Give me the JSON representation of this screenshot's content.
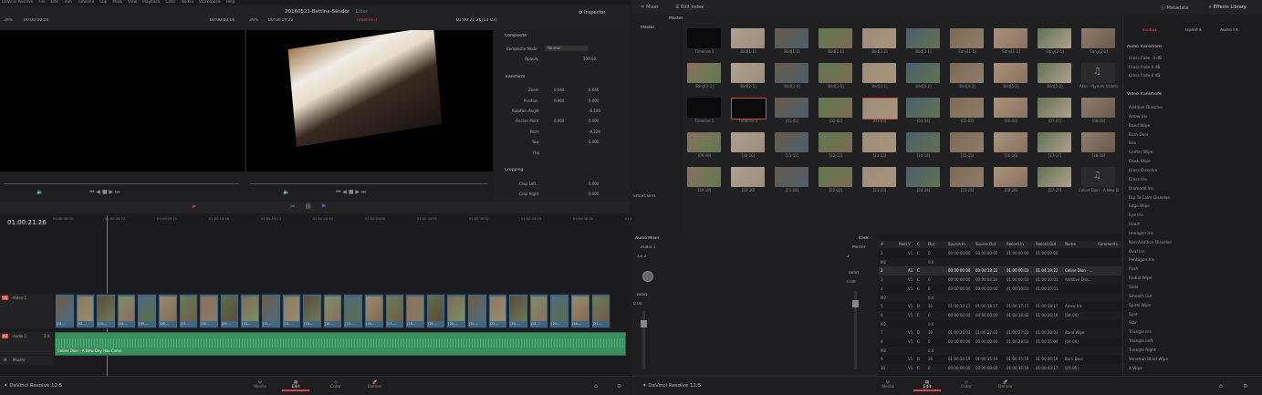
{
  "menubar": {
    "items": [
      "DaVinci Resolve",
      "File",
      "Edit",
      "Trim",
      "Timeline",
      "Clip",
      "Mark",
      "View",
      "Playback",
      "Color",
      "Nodes",
      "Workspace",
      "Help"
    ]
  },
  "source_viewer": {
    "zoom": "39%",
    "timecode": "00:00:00:00",
    "end_tc": "00:00:00:00"
  },
  "timeline_viewer": {
    "title": "20160521-Bettina-Sándor",
    "status": "Edited",
    "zoom": "39%",
    "duration": "00:04:19:22",
    "timeline_name": "Timeline 3",
    "timecode": "01:00:21:26",
    "clip_tag": "[03-03]"
  },
  "inspector": {
    "tab": "Inspector",
    "composite": {
      "header": "Composite",
      "mode_label": "Composite Mode",
      "mode_value": "Normal",
      "opacity_label": "Opacity",
      "opacity_value": "100.00"
    },
    "transform": {
      "header": "Transform",
      "zoom_label": "Zoom",
      "zoom_x": "0.640",
      "zoom_y": "0.640",
      "position_label": "Position",
      "pos_x": "0.000",
      "pos_y": "0.000",
      "rotation_label": "Rotation Angle",
      "rotation_value": "-6.100",
      "anchor_label": "Anchor Point",
      "anchor_x": "0.000",
      "anchor_y": "0.000",
      "pitch_label": "Pitch",
      "pitch_value": "-0.229",
      "yaw_label": "Yaw",
      "yaw_value": "0.000",
      "flip_label": "Flip"
    },
    "cropping": {
      "header": "Cropping",
      "crop_left_label": "Crop Left",
      "crop_left": "0.000",
      "crop_right_label": "Crop Right",
      "crop_right": "0.000"
    }
  },
  "timeline": {
    "timecode": "01:00:21:26",
    "ruler": [
      "01:00:00:00",
      "01:00:04:22",
      "01:00:09:19",
      "01:00:14:16",
      "01:00:19:13",
      "01:00:24:10",
      "01:00:29:08",
      "01:00:34:05",
      "01:00:39:02",
      "01:00:43:29",
      "01:00:48:26",
      "01:00:53:24"
    ],
    "video_track": {
      "id": "V1",
      "name": "Video 1"
    },
    "audio_track": {
      "id": "A1",
      "name": "Audio 1",
      "level": "2.0"
    },
    "master_track": {
      "id": "M",
      "name": "Master"
    },
    "audio_clip_name": "Celine Dion - A New Day Has Come",
    "clip_labels": [
      "[01-...",
      "[02-...",
      "[03-...",
      "[04-...",
      "[05-...",
      "[06-...",
      "[07-...",
      "[08-...",
      "[09-...",
      "[10-...",
      "[11-...",
      "[12-...",
      "[13-...",
      "[14-...",
      "[15-...",
      "[16-...",
      "[17-...",
      "[18-...",
      "[19-...",
      "[20-...",
      "[21-...",
      "[22-...",
      "[23-...",
      "[24-...",
      "[25-...",
      "[26-...",
      "[27-..."
    ]
  },
  "bottom_bar_left": {
    "app": "DaVinci Resolve 12.5",
    "pages": [
      "Media",
      "Edit",
      "Color",
      "Deliver"
    ],
    "active": "Edit"
  },
  "bottom_bar_right": {
    "app": "DaVinci Resolve 12.5",
    "pages": [
      "Media",
      "Edit",
      "Color",
      "Deliver"
    ],
    "active": "Edit"
  },
  "media_pool": {
    "tabs": {
      "mixer": "Mixer",
      "edit_index": "Edit Index",
      "metadata": "Metadata",
      "effects_library": "Effects Library"
    },
    "bin_header": "Master",
    "bins": {
      "master": "Master",
      "smart_bins": "Smart Bins"
    },
    "thumbnails": [
      "Timeline 1",
      "Bild[1-1]",
      "Bild[1-2]",
      "Bild[2-1]",
      "Bild[2-2]",
      "Bild[3-1]",
      "Sany[1-1]",
      "Sany[1-2]",
      "Sany[2-1]",
      "Sany[2-2]",
      "Sany[3-1]",
      "Bild[2-5]",
      "Bild[3-4]",
      "Bild[3-5]",
      "Bild[4-1]",
      "Bild[4-2]",
      "Bild[4-3]",
      "Bild[5-1]",
      "Bild[5-2]",
      "Akos - Nyerek Valami",
      "Timeline 2",
      "Timeline 3",
      "[01-01]",
      "[02-02]",
      "[03-03]",
      "[04-04]",
      "[05-05]",
      "[06-06]",
      "[07-07]",
      "[08-08]",
      "[09-09]",
      "[10-10]",
      "[11-11]",
      "[12-12]",
      "[13-13]",
      "[14-14]",
      "[15-15]",
      "[16-16]",
      "[17-17]",
      "[18-18]",
      "[19-19]",
      "[20-20]",
      "[21-21]",
      "[22-22]",
      "[23-23]",
      "[24-24]",
      "[25-25]",
      "[26-26]",
      "[27-27]",
      "Celine Dion - A New Day Has Come"
    ]
  },
  "audio_mixer": {
    "title": "Audio Mixer",
    "track_label": "Track",
    "channel": "Audio 1",
    "channel_format": "1 ▸ 2",
    "master": "Master",
    "master_val": "2",
    "mode_read": "Read",
    "level": "0.00"
  },
  "edit_index": {
    "columns": [
      "#",
      "Reel",
      "V",
      "C",
      "Dur",
      "Source In",
      "Source Out",
      "Record In",
      "Record Out",
      "Name",
      "Comments"
    ],
    "rows": [
      [
        "1",
        "",
        "V1",
        "C",
        "0",
        "00:00:00:00",
        "00:00:00:00",
        "01:00:00:00",
        "01:00:00:00",
        "",
        ""
      ],
      [
        "M2",
        "",
        "",
        "",
        "0.0",
        "",
        "",
        "",
        "",
        "",
        ""
      ],
      [
        "2",
        "",
        "A1",
        "C",
        "",
        "00:00:00:00",
        "00:04:18:22",
        "01:00:00:03",
        "01:04:19:22",
        "Celine Dion - ...",
        ""
      ],
      [
        "3",
        "",
        "V1",
        "C",
        "0",
        "00:00:00:00",
        "00:00:04:16",
        "01:00:00:03",
        "01:00:10:01",
        "Additive Diss...",
        ""
      ],
      [
        "4",
        "",
        "V1",
        "C",
        "0",
        "00:00:00:00",
        "00:00:00:00",
        "01:00:10:01",
        "01:00:10:01",
        "",
        ""
      ],
      [
        "M2",
        "",
        "",
        "",
        "0.0",
        "",
        "",
        "",
        "",
        "",
        ""
      ],
      [
        "5",
        "",
        "V1",
        "D",
        "30",
        "01:00:12:17",
        "01:00:18:17",
        "01:00:17:17",
        "01:00:18:17",
        "Arrow Iris",
        ""
      ],
      [
        "6",
        "",
        "V1",
        "C",
        "0",
        "00:00:00:00",
        "00:00:00:00",
        "01:00:18:02",
        "01:00:26:18",
        "[04-04]",
        ""
      ],
      [
        "M2",
        "",
        "",
        "",
        "0.0",
        "",
        "",
        "",
        "",
        "",
        ""
      ],
      [
        "7",
        "",
        "V1",
        "D",
        "30",
        "01:00:26:03",
        "01:00:27:03",
        "01:00:27:03",
        "01:00:28:03",
        "Band Wipe",
        ""
      ],
      [
        "8",
        "",
        "V1",
        "C",
        "0",
        "00:00:00:00",
        "00:00:00:00",
        "01:00:28:03",
        "01:00:35:04",
        "[04-04]",
        ""
      ],
      [
        "M2",
        "",
        "",
        "",
        "0.0",
        "",
        "",
        "",
        "",
        "",
        ""
      ],
      [
        "9",
        "",
        "V1",
        "D",
        "30",
        "01:00:34:19",
        "01:00:35:19",
        "01:00:35:19",
        "01:00:36:19",
        "Barn Door",
        ""
      ],
      [
        "10",
        "",
        "V1",
        "C",
        "0",
        "00:00:00:00",
        "00:00:00:00",
        "01:00:36:19",
        "01:00:43:17",
        "[05-05]",
        ""
      ]
    ]
  },
  "effects_library": {
    "tabs": [
      "Toolbox",
      "OpenFX",
      "Audio FX"
    ],
    "audio_header": "Audio Transitions",
    "audio_items": [
      "Cross Fade -3 dB",
      "Cross Fade 0 dB",
      "Cross Fade 0 dB"
    ],
    "video_header": "Video Transitions",
    "video_items": [
      "Additive Dissolve",
      "Arrow Iris",
      "Band Wipe",
      "Barn Door",
      "Box",
      "Center Wipe",
      "Clock Wipe",
      "Cross Dissolve",
      "Cross Iris",
      "Diamond Iris",
      "Dip To Color Dissolve",
      "Edge Wipe",
      "Eye Iris",
      "Heart",
      "Hexagon Iris",
      "Non-Additive Dissolve",
      "Oval Iris",
      "Pentagon Iris",
      "Push",
      "Radial Wipe",
      "Slide",
      "Smooth Cut",
      "Spiral Wipe",
      "Split",
      "Star",
      "Triangle Iris",
      "Triangle Left",
      "Triangle Right",
      "Venetian Blind Wipe",
      "X Wipe"
    ]
  },
  "colors": {
    "accent_red": "#e0474c",
    "audio_green": "#3fa36b",
    "video_blue": "#4a6f8a",
    "selected_border": "#d64a3c"
  }
}
